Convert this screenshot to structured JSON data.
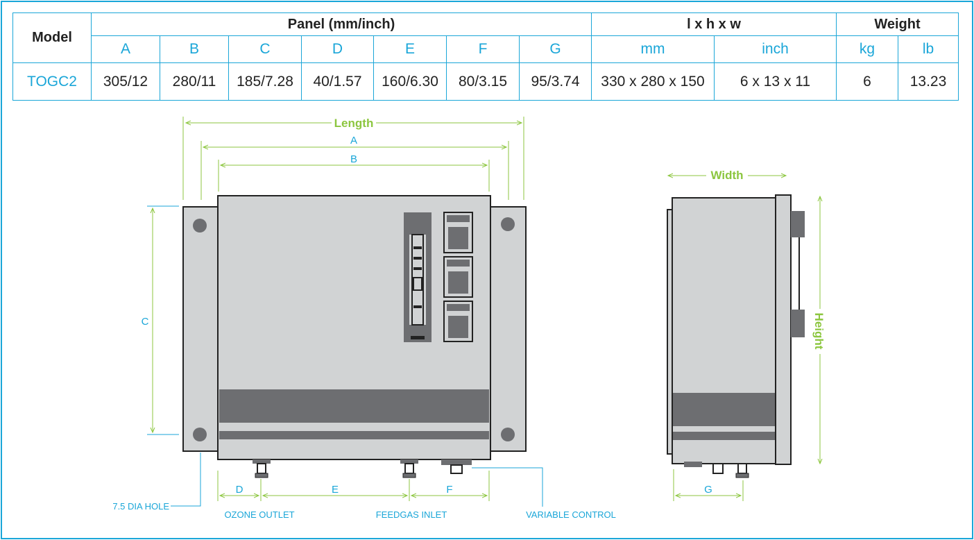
{
  "table": {
    "model_header": "Model",
    "group_headers": {
      "panel": "Panel (mm/inch)",
      "dims": "l x h x w",
      "weight": "Weight"
    },
    "sub_headers": [
      "A",
      "B",
      "C",
      "D",
      "E",
      "F",
      "G",
      "mm",
      "inch",
      "kg",
      "lb"
    ],
    "rows": [
      {
        "model": "TOGC2",
        "cells": [
          "305/12",
          "280/11",
          "185/7.28",
          "40/1.57",
          "160/6.30",
          "80/3.15",
          "95/3.74",
          "330 x 280 x 150",
          "6 x 13 x 11",
          "6",
          "13.23"
        ]
      }
    ]
  },
  "diagram": {
    "dim_labels": {
      "length": "Length",
      "a": "A",
      "b": "B",
      "c": "C",
      "d": "D",
      "e": "E",
      "f": "F",
      "g": "G",
      "width": "Width",
      "height": "Height"
    },
    "callouts": {
      "hole": "7.5 DIA HOLE",
      "ozone": "OZONE OUTLET",
      "feedgas": "FEEDGAS INLET",
      "variable": "VARIABLE CONTROL"
    }
  },
  "colors": {
    "accent_blue": "#1aa6d8",
    "accent_green": "#8cc63f",
    "panel_gray": "#d1d3d4",
    "dark_gray": "#6d6e71"
  }
}
